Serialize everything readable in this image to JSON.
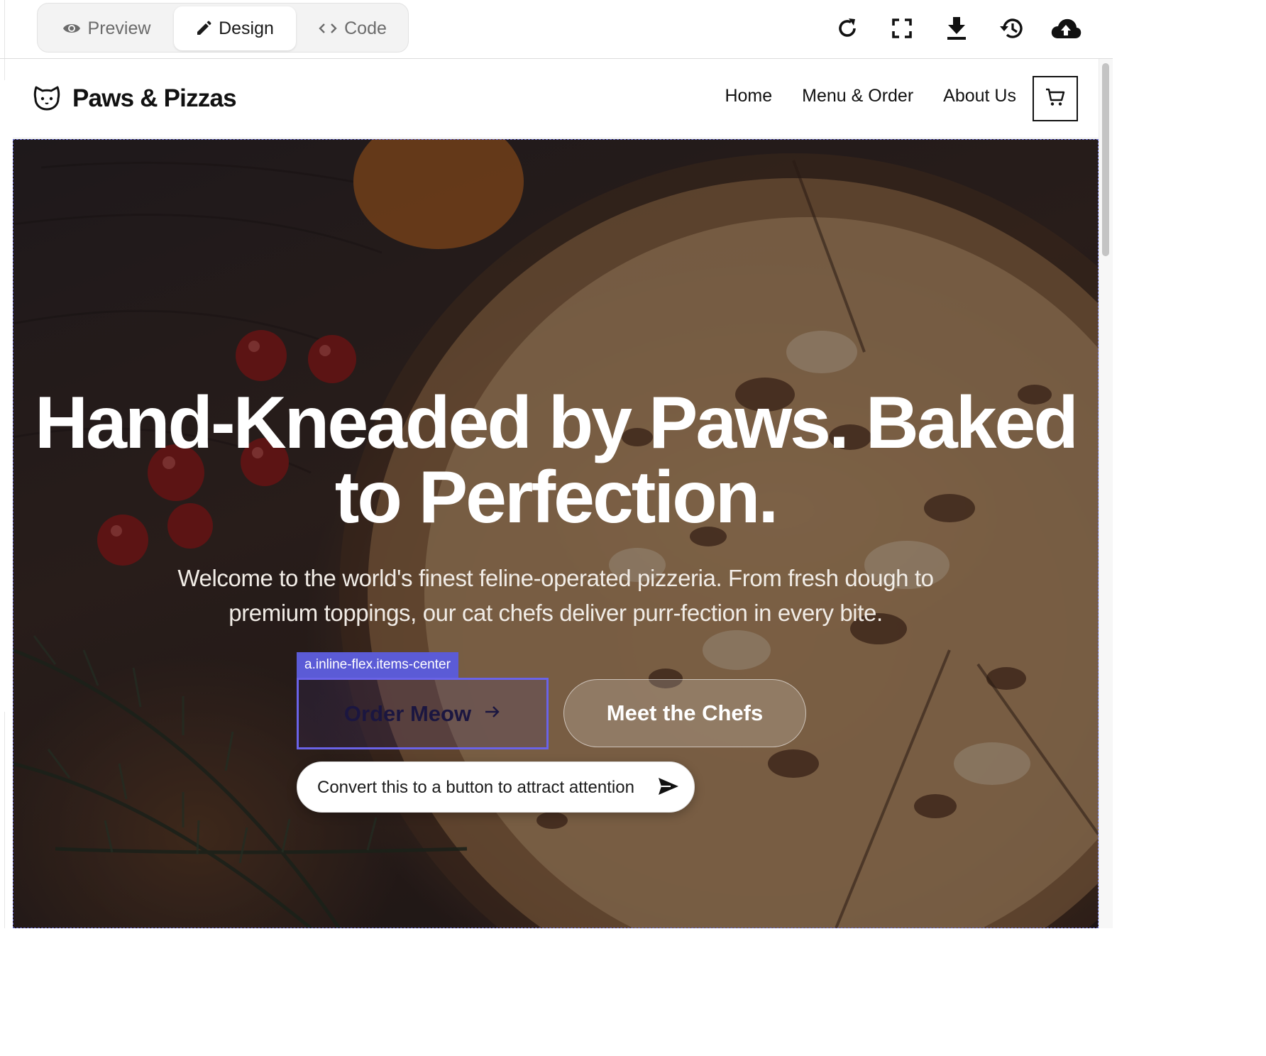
{
  "editor": {
    "modes": [
      {
        "label": "Preview",
        "icon": "eye-icon"
      },
      {
        "label": "Design",
        "icon": "pencil-icon"
      },
      {
        "label": "Code",
        "icon": "code-icon"
      }
    ],
    "active_mode": "Design",
    "toolbar_icons": [
      "refresh-icon",
      "fullscreen-icon",
      "download-icon",
      "history-icon",
      "cloud-upload-icon"
    ]
  },
  "site": {
    "brand": {
      "name": "Paws & Pizzas",
      "icon": "cat-icon"
    },
    "nav": {
      "links": [
        "Home",
        "Menu & Order",
        "About Us"
      ],
      "cart_icon": "cart-icon"
    },
    "hero": {
      "title_line1": "Hand-Kneaded by Paws. Baked",
      "title_line2": "to Perfection.",
      "subtitle": "Welcome to the world's finest feline-operated pizzeria. From fresh dough to premium toppings, our cat chefs deliver purr-fection in every bite.",
      "primary_button": "Order Meow",
      "secondary_button": "Meet the Chefs"
    }
  },
  "selection": {
    "tag": "a.inline-flex.items-center",
    "accent_color": "#5b5bd6"
  },
  "prompt": {
    "value": "Convert this to a button to attract attention",
    "send_icon": "send-icon"
  }
}
